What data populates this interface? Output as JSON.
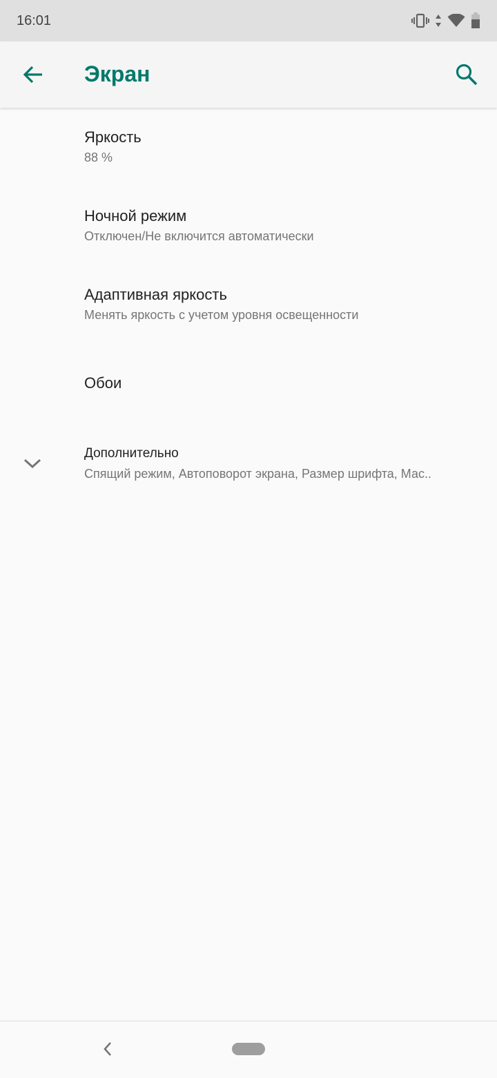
{
  "status_bar": {
    "time": "16:01",
    "icons": [
      "vibrate-icon",
      "data-arrows-icon",
      "wifi-icon",
      "battery-icon"
    ]
  },
  "app_bar": {
    "title": "Экран",
    "back_icon": "arrow-left-icon",
    "search_icon": "search-icon",
    "accent_color": "#00796b"
  },
  "settings": {
    "items": [
      {
        "title": "Яркость",
        "summary": "88 %"
      },
      {
        "title": "Ночной режим",
        "summary": "Отключен/Не включится автоматически"
      },
      {
        "title": "Адаптивная яркость",
        "summary": "Менять яркость с учетом уровня освещенности"
      },
      {
        "title": "Обои"
      },
      {
        "title": "Дополнительно",
        "summary": "Спящий режим, Автоповорот экрана, Размер шрифта, Мас..",
        "icon": "chevron-down-icon"
      }
    ]
  },
  "nav_bar": {
    "back_icon": "nav-back-icon",
    "home_icon": "home-pill-icon"
  }
}
